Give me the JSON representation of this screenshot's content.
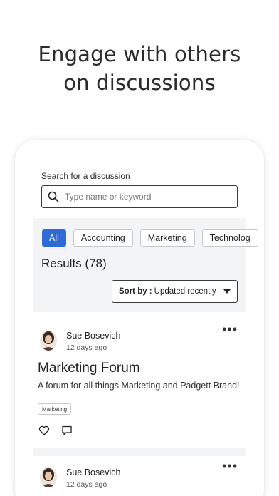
{
  "headline": {
    "line1": "Engage with others",
    "line2": "on discussions"
  },
  "search": {
    "label": "Search for a discussion",
    "placeholder": "Type name or keyword"
  },
  "filters": {
    "chips": [
      "All",
      "Accounting",
      "Marketing",
      "Technolog"
    ],
    "active": "All"
  },
  "results": {
    "label": "Results (78)"
  },
  "sort": {
    "prefix": "Sort by :",
    "value": "Updated recently"
  },
  "posts": [
    {
      "author": "Sue Bosevich",
      "date": "12 days ago",
      "title": "Marketing Forum",
      "description": "A forum for all things Marketing and Padgett Brand!",
      "tag": "Marketing"
    },
    {
      "author": "Sue Bosevich",
      "date": "12 days ago"
    }
  ],
  "colors": {
    "accent": "#2f6bd6",
    "panel": "#f3f4f6"
  },
  "icons": [
    "search-icon",
    "more-icon",
    "heart-icon",
    "comment-icon",
    "chevron-down-icon"
  ]
}
